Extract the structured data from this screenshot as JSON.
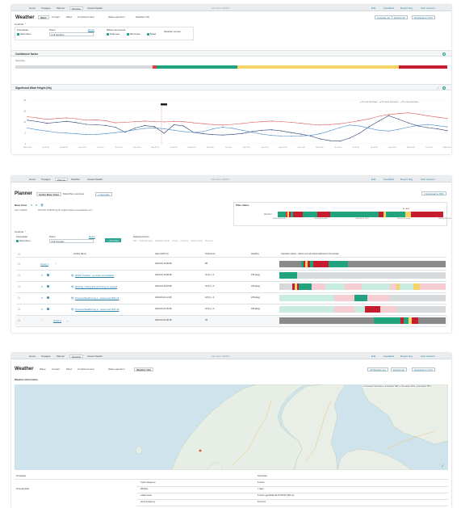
{
  "nav": {
    "tabs": [
      "Home",
      "Voyages",
      "Planner",
      "Weather",
      "Vessel Details"
    ],
    "center_title": "Simulator DEMO",
    "right_links": [
      "Edit",
      "Feedback",
      "Report bug",
      "User account"
    ]
  },
  "weather1": {
    "title": "Weather",
    "subtabs": [
      "Wave",
      "Current",
      "Wind",
      "Combined view",
      "Wave spectrum",
      "Weather Info"
    ],
    "buttons": [
      "Compare all",
      "Explore all",
      "Download to CSV"
    ],
    "controls_label": "Controls",
    "forecaster_label": "Forecaster",
    "forecaster_value": "StormGeo",
    "zoom_label": "Zoom",
    "zoom_reset": "Reset",
    "zoom_value": "Full duration",
    "wave_component_label": "Wave component",
    "wave_components": [
      "Total sea",
      "Wind sea",
      "Swell"
    ],
    "weather_sensor_label": "Weather sensor",
    "confidence_title": "Confidence factor",
    "confidence_source": "StormGeo",
    "chart_title": "Significant Wave Height (Hs)",
    "legend": [
      "Hs max StormGeo",
      "Hs mean StormGeo",
      "Hs_calc StormGeo"
    ]
  },
  "chart_data": {
    "type": "line",
    "title": "Significant Wave Height (Hs)",
    "x_ticks": [
      "Mon 07:00",
      "Tue 07:00",
      "Wed 07:00",
      "Thu 07:00",
      "Fri 07:00",
      "Sat 07:00",
      "Sun 07:00",
      "Mon 07:00",
      "Tue 07:00",
      "Wed 07:00",
      "Thu 07:00",
      "Fri 07:00",
      "Sat 07:00",
      "Sun 07:00",
      "Mon 07:00",
      "Tue 07:00",
      "Wed 07:00",
      "Thu 07:00",
      "Fri 07:00",
      "Sat 07:00",
      "Sun 07:00",
      "Mon 07:00",
      "Tue 07:00",
      "Wed 07:00"
    ],
    "y_ticks": [
      "0",
      "5",
      "10",
      "15",
      "20"
    ],
    "ylim": [
      0,
      20
    ],
    "series": [
      {
        "name": "Hs max StormGeo",
        "color": "#e05a5a",
        "values": [
          12.4,
          11.8,
          11.2,
          11.6,
          11.9,
          11.5,
          10.8,
          10.9,
          10.6,
          9.6,
          9.8,
          10.1,
          10.4,
          10.2,
          10.0,
          10.3,
          10.1,
          9.6,
          9.2,
          8.8,
          8.6,
          8.9,
          9.3,
          9.8,
          10.1,
          10.4,
          10.2,
          9.8,
          9.4,
          8.9,
          8.6,
          8.8,
          9.2,
          9.8,
          10.6,
          11.4,
          12.6,
          13.4,
          13.8,
          14.2,
          13.6,
          12.8,
          12.2,
          11.6
        ]
      },
      {
        "name": "Hs mean StormGeo",
        "color": "#2a3f73",
        "values": [
          10.8,
          10.2,
          9.4,
          9.8,
          10.3,
          9.7,
          8.9,
          8.7,
          8.4,
          7.6,
          5.3,
          7.2,
          8.3,
          7.9,
          4.8,
          8.7,
          8.1,
          5.2,
          4.6,
          4.2,
          4.0,
          4.3,
          4.7,
          5.6,
          6.2,
          6.4,
          5.9,
          5.1,
          4.4,
          3.6,
          2.2,
          1.4,
          1.2,
          2.6,
          4.8,
          7.9,
          10.4,
          12.9,
          11.3,
          9.6,
          8.2,
          7.4,
          6.8,
          6.0
        ]
      },
      {
        "name": "Hs_calc StormGeo",
        "color": "#4c8cc9",
        "values": [
          7.2,
          6.4,
          5.8,
          5.2,
          4.9,
          4.6,
          4.2,
          4.3,
          4.6,
          5.1,
          5.6,
          6.4,
          7.0,
          7.3,
          6.9,
          6.2,
          5.6,
          5.2,
          5.6,
          6.8,
          7.6,
          7.1,
          6.2,
          5.3,
          4.4,
          3.8,
          3.6,
          3.5,
          3.6,
          3.8,
          4.6,
          6.0,
          7.4,
          8.6,
          8.2,
          7.1,
          6.2,
          5.8,
          6.6,
          7.6,
          8.4,
          8.8,
          8.3,
          7.7
        ]
      }
    ]
  },
  "planner": {
    "title": "Planner",
    "subtabs": [
      "Active Base Case",
      "Multi-Plan overview"
    ],
    "new_plan_button": "New plan",
    "download_button": "Download to PDF",
    "base_case_label": "Base Case",
    "last_modified_label": "Last modified:",
    "last_modified_value": "2024-09-19 08:08 by jhh.no@simulator.oceanaddress.com",
    "plan_status_label": "Plan status:",
    "plan_status_row": "Weather",
    "plan_status_times": [
      "2024-09-20 12:00",
      "2024-09-21 00:00",
      "2024-09-21 12:00",
      "2024-09-22 00:00",
      "2024-09-22 12:00"
    ],
    "controls_label": "Controls",
    "forecaster_label": "Forecaster",
    "forecaster_value": "StormGeo",
    "zoom_label": "Zoom",
    "zoom_reset": "Reset",
    "zoom_value": "Full forecast",
    "add_step_button": "Add Step",
    "selected_items_label": "Selected items",
    "selected_actions": [
      "Edit",
      "Duplicate step",
      "Duplicate group",
      "Group",
      "Ungroup",
      "Add to group",
      "Remove"
    ],
    "columns": [
      "Activity Name",
      "Start (GMT+2)",
      "Total hours",
      "Heading",
      "Operation status - Worst over all criteria defined for the activity"
    ],
    "rows": [
      {
        "name": "Group 1",
        "start": "2024-09-19 08:48",
        "hours": "88",
        "heading": ""
      },
      {
        "name": "MOCF Position - go down and stabilize",
        "start": "2024-09-19 08:48",
        "hours": "10 (h) + 0",
        "heading": "155 [deg]"
      },
      {
        "name": "Mooring, towing and anchoring as needed",
        "start": "2024-09-19 18:48",
        "hours": "42 (h) + 0",
        "heading": "240 [deg]"
      },
      {
        "name": "Proceed Weather leg 1 - speed and 50% eff",
        "start": "2024-09-21 12:48",
        "hours": "18 (h) + 0",
        "heading": "245 [deg]"
      },
      {
        "name": "Proceed Weather leg 2 - speed and 50% eff",
        "start": "2024-09-22 06:48",
        "hours": "18 (h) + 0",
        "heading": "180 [deg]"
      },
      {
        "name": "Group 2",
        "start": "2024-09-22 00:48",
        "hours": "48",
        "heading": ""
      }
    ]
  },
  "weather3": {
    "title": "Weather",
    "subtabs": [
      "Wave",
      "Current",
      "Wind",
      "Combined view",
      "Wave spectrum",
      "Weather Info"
    ],
    "buttons": [
      "All Weather sel.",
      "Explore all",
      "Download to CSV"
    ],
    "section_title": "Weather information",
    "map_legend": [
      "Forecaster StormGeo",
      "Forecaster MET",
      "Forecaster DNV",
      "Forecaster WNI"
    ],
    "info_headers": [
      "Forecaster",
      "StormGeo"
    ],
    "info_rows": [
      {
        "group": "",
        "key": "Cycle frequency",
        "value": "6 hours"
      },
      {
        "group": "Forecast data",
        "key": "Window",
        "value": "7 days"
      },
      {
        "group": "",
        "key": "Latest issue",
        "value": "5 hours ago(2024-09-19 08:00 GMT+2)"
      },
      {
        "group": "",
        "key": "Issue frequency",
        "value": "12 hours"
      }
    ]
  }
}
